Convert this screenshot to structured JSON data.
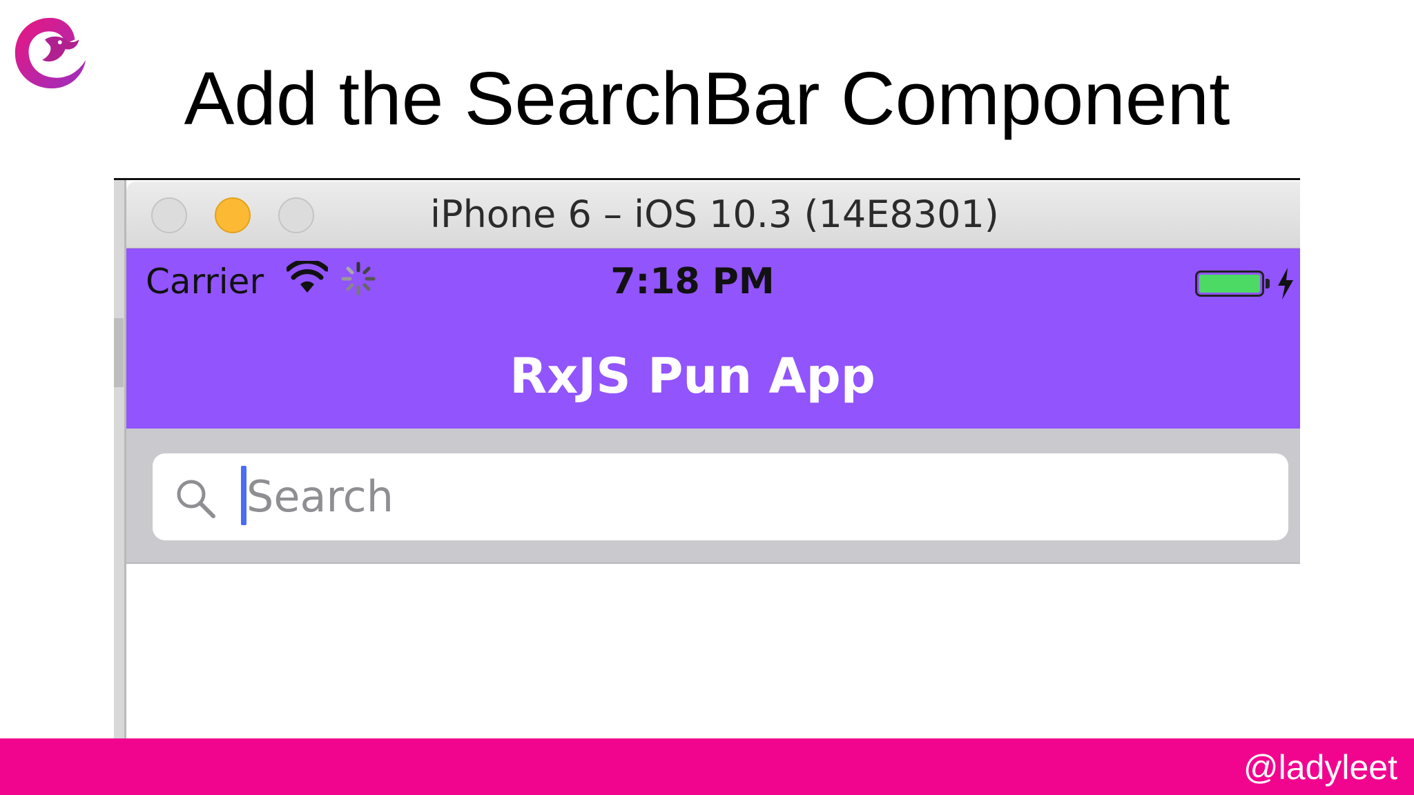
{
  "slide": {
    "title": "Add the SearchBar Component",
    "footer_handle": "@ladyleet",
    "colors": {
      "footer": "#f2058e",
      "logo_primary": "#e6168c",
      "logo_secondary": "#8a2be2"
    },
    "logo_icon": "rxjs-logo-icon"
  },
  "simulator": {
    "window_title": "iPhone 6 – iOS 10.3 (14E8301)",
    "traffic_lights": [
      "close",
      "minimize",
      "zoom"
    ],
    "status_bar": {
      "carrier": "Carrier",
      "time": "7:18 PM",
      "wifi_icon": "wifi-icon",
      "activity_icon": "network-activity-spinner-icon",
      "battery_icon": "battery-full-charging-icon"
    },
    "app": {
      "nav_title": "RxJS Pun App",
      "accent_color": "#9254fd",
      "search": {
        "placeholder": "Search",
        "value": "",
        "icon": "magnifier-icon"
      }
    }
  }
}
